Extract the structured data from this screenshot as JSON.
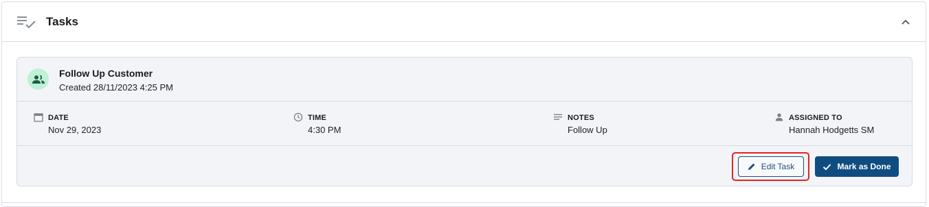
{
  "header": {
    "title": "Tasks",
    "icon": "task-list-icon",
    "collapse_icon": "chevron-up-icon"
  },
  "task": {
    "title": "Follow Up Customer",
    "created": "Created 28/11/2023 4:25 PM",
    "avatar_icon": "people-icon",
    "fields": {
      "date": {
        "label": "DATE",
        "value": "Nov 29, 2023",
        "icon": "calendar-icon"
      },
      "time": {
        "label": "TIME",
        "value": "4:30 PM",
        "icon": "clock-icon"
      },
      "notes": {
        "label": "NOTES",
        "value": "Follow Up",
        "icon": "notes-icon"
      },
      "assigned": {
        "label": "ASSIGNED TO",
        "value": "Hannah Hodgetts SM",
        "icon": "person-icon"
      }
    },
    "actions": {
      "edit_label": "Edit Task",
      "done_label": "Mark as Done"
    }
  },
  "colors": {
    "accent": "#0f4c81",
    "highlight": "#e02424",
    "avatar_bg": "#bff0d8",
    "card_bg": "#f3f4f7"
  }
}
